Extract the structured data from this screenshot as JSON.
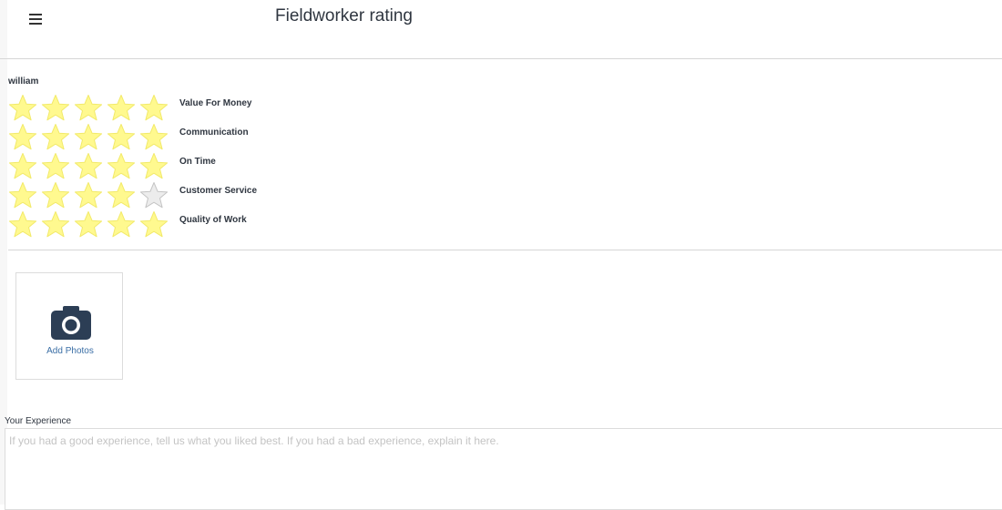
{
  "header": {
    "title": "Fieldworker rating",
    "menu_icon": "hamburger-menu-icon"
  },
  "worker": {
    "name": "william"
  },
  "ratings": [
    {
      "label": "Value For Money",
      "stars": 5,
      "max": 5
    },
    {
      "label": "Communication",
      "stars": 5,
      "max": 5
    },
    {
      "label": "On Time",
      "stars": 5,
      "max": 5
    },
    {
      "label": "Customer Service",
      "stars": 4,
      "max": 5
    },
    {
      "label": "Quality of Work",
      "stars": 5,
      "max": 5
    }
  ],
  "colors": {
    "star_filled": "#fff98f",
    "star_filled_stroke": "#f2ea6a",
    "star_empty": "#ececec",
    "star_empty_stroke": "#c4c4c4",
    "camera": "#2c3e55",
    "link": "#3a6ea5"
  },
  "photos": {
    "label": "Add Photos",
    "icon": "camera-icon"
  },
  "experience": {
    "label": "Your Experience",
    "placeholder": "If you had a good experience, tell us what you liked best. If you had a bad experience, explain it here.",
    "value": ""
  }
}
